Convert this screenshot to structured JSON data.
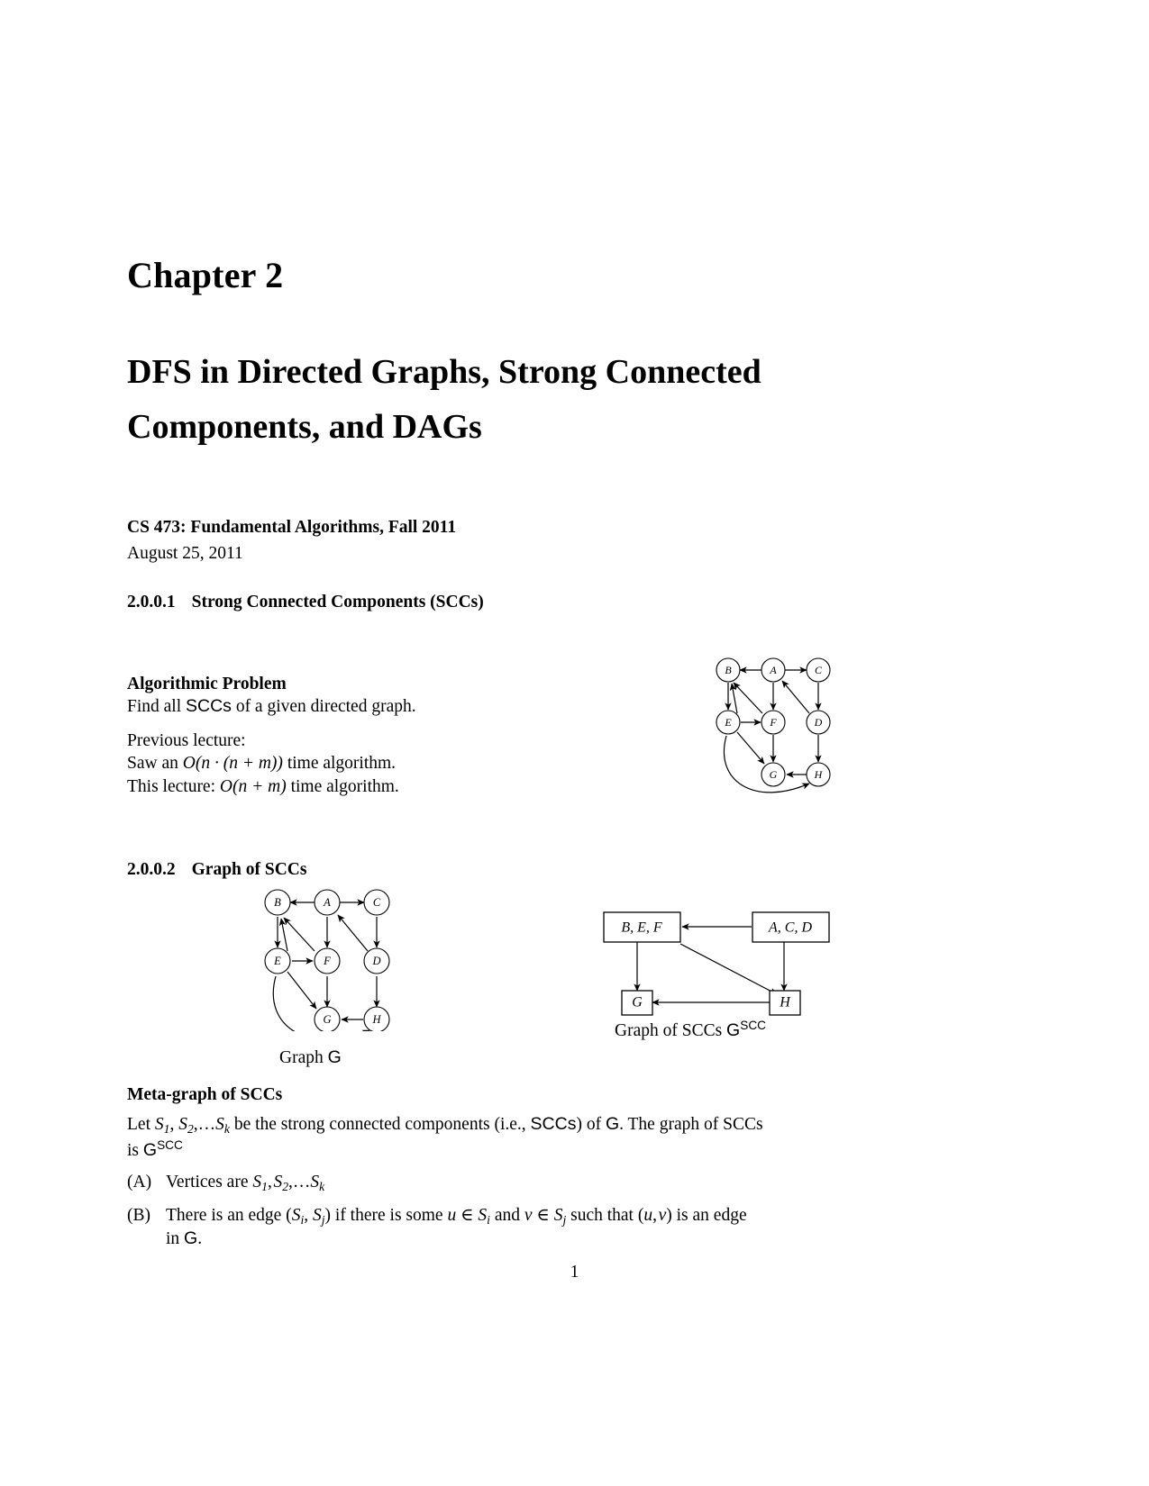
{
  "document": {
    "chapter_number": "Chapter 2",
    "chapter_title": "DFS in Directed Graphs, Strong Connected Components, and DAGs",
    "course": "CS 473: Fundamental Algorithms, Fall 2011",
    "date": "August 25, 2011",
    "page_number": "1"
  },
  "section_sccs": {
    "number": "2.0.0.1",
    "title": "Strong Connected Components (SCCs)"
  },
  "algorithmic_problem": {
    "heading": "Algorithmic Problem",
    "line1_a": "Find all ",
    "line1_sf": "SCCs",
    "line1_b": " of a given directed graph."
  },
  "previous_lecture": {
    "line1": "Previous lecture:",
    "line2_a": "Saw an ",
    "line2_math": "O(n · (n + m))",
    "line2_b": " time algorithm.",
    "line3_a": "This lecture:  ",
    "line3_math": "O(n + m)",
    "line3_b": " time algorithm."
  },
  "section_graph_of_sccs": {
    "number": "2.0.0.2",
    "title": "Graph of SCCs"
  },
  "figures": {
    "graph_g_caption_prefix": "Graph ",
    "graph_g_caption_symbol": "G",
    "scc_caption_prefix": "Graph of SCCs ",
    "scc_caption_symbol": "G",
    "scc_caption_sup": "SCC"
  },
  "meta_graph": {
    "heading": "Meta-graph of SCCs",
    "para_1a": "Let ",
    "para_1_s1": "S",
    "para_1_s1sub": "1",
    "para_1_s2": "S",
    "para_1_s2sub": "2",
    "para_1_sk": "S",
    "para_1_sksub": "k",
    "para_1b": " be the strong connected components (i.e., ",
    "para_1_sf1": "SCCs",
    "para_1c": ") of ",
    "para_1_sf2": "G",
    "para_1d": ". The graph of SCCs",
    "para_2a": "is ",
    "para_2_sf": "G",
    "para_2_sup": "SCC",
    "item_a_label": "(A)",
    "item_a_text": "Vertices are ",
    "item_b_label": "(B)",
    "item_b_1": "There is an edge (",
    "item_b_2": ") if there is some ",
    "item_b_3": " and ",
    "item_b_4": " such that (",
    "item_b_5": ") is an edge",
    "item_b_6": "in ",
    "item_b_7": "G",
    "item_b_8": "."
  },
  "graph_digraph": {
    "nodes": [
      "A",
      "B",
      "C",
      "D",
      "E",
      "F",
      "G",
      "H"
    ],
    "edges": [
      [
        "A",
        "B"
      ],
      [
        "A",
        "C"
      ],
      [
        "A",
        "F"
      ],
      [
        "B",
        "E"
      ],
      [
        "C",
        "D"
      ],
      [
        "D",
        "A"
      ],
      [
        "D",
        "H"
      ],
      [
        "E",
        "B"
      ],
      [
        "E",
        "F"
      ],
      [
        "E",
        "G"
      ],
      [
        "E",
        "H"
      ],
      [
        "F",
        "G"
      ],
      [
        "H",
        "G"
      ]
    ]
  },
  "graph_scc": {
    "nodes": [
      "B, E, F",
      "A, C, D",
      "G",
      "H"
    ],
    "edges": [
      [
        "A, C, D",
        "B, E, F"
      ],
      [
        "A, C, D",
        "H"
      ],
      [
        "B, E, F",
        "G"
      ],
      [
        "B, E, F",
        "H"
      ],
      [
        "H",
        "G"
      ]
    ]
  },
  "colors": {
    "text": "#000000",
    "background": "#ffffff",
    "stroke": "#000000"
  }
}
